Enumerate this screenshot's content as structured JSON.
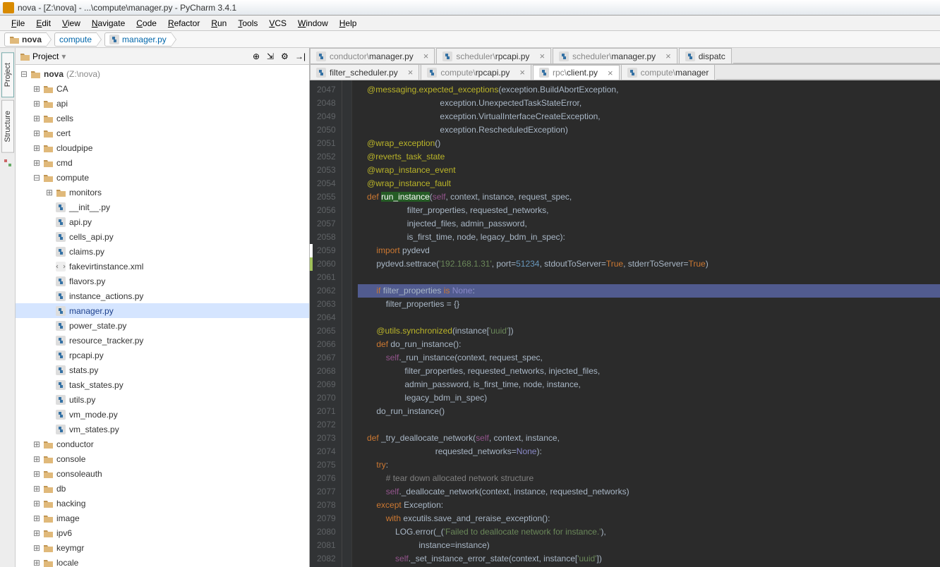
{
  "window": {
    "title": "nova - [Z:\\nova] - ...\\compute\\manager.py - PyCharm 3.4.1"
  },
  "menu": [
    "File",
    "Edit",
    "View",
    "Navigate",
    "Code",
    "Refactor",
    "Run",
    "Tools",
    "VCS",
    "Window",
    "Help"
  ],
  "breadcrumb": [
    {
      "label": "nova",
      "icon": "dir"
    },
    {
      "label": "compute",
      "icon": null
    },
    {
      "label": "manager.py",
      "icon": "py"
    }
  ],
  "project_panel": {
    "title": "Project",
    "toolbar_icons": [
      "target-icon",
      "collapse-icon",
      "gear-icon",
      "hide-icon"
    ]
  },
  "side_tabs": [
    "Project",
    "Structure"
  ],
  "tree": [
    {
      "depth": 0,
      "toggle": "−",
      "icon": "dir",
      "label": "nova",
      "suffix": "(Z:\\nova)",
      "bold": true
    },
    {
      "depth": 1,
      "toggle": "+",
      "icon": "dir",
      "label": "CA"
    },
    {
      "depth": 1,
      "toggle": "+",
      "icon": "dir",
      "label": "api"
    },
    {
      "depth": 1,
      "toggle": "+",
      "icon": "dir",
      "label": "cells"
    },
    {
      "depth": 1,
      "toggle": "+",
      "icon": "dir",
      "label": "cert"
    },
    {
      "depth": 1,
      "toggle": "+",
      "icon": "dir",
      "label": "cloudpipe"
    },
    {
      "depth": 1,
      "toggle": "+",
      "icon": "dir",
      "label": "cmd"
    },
    {
      "depth": 1,
      "toggle": "−",
      "icon": "dir",
      "label": "compute"
    },
    {
      "depth": 2,
      "toggle": "+",
      "icon": "dir",
      "label": "monitors"
    },
    {
      "depth": 2,
      "toggle": "",
      "icon": "py",
      "label": "__init__.py"
    },
    {
      "depth": 2,
      "toggle": "",
      "icon": "py",
      "label": "api.py"
    },
    {
      "depth": 2,
      "toggle": "",
      "icon": "py",
      "label": "cells_api.py"
    },
    {
      "depth": 2,
      "toggle": "",
      "icon": "py",
      "label": "claims.py"
    },
    {
      "depth": 2,
      "toggle": "",
      "icon": "xml",
      "label": "fakevirtinstance.xml"
    },
    {
      "depth": 2,
      "toggle": "",
      "icon": "py",
      "label": "flavors.py"
    },
    {
      "depth": 2,
      "toggle": "",
      "icon": "py",
      "label": "instance_actions.py"
    },
    {
      "depth": 2,
      "toggle": "",
      "icon": "py",
      "label": "manager.py",
      "selected": true
    },
    {
      "depth": 2,
      "toggle": "",
      "icon": "py",
      "label": "power_state.py"
    },
    {
      "depth": 2,
      "toggle": "",
      "icon": "py",
      "label": "resource_tracker.py"
    },
    {
      "depth": 2,
      "toggle": "",
      "icon": "py",
      "label": "rpcapi.py"
    },
    {
      "depth": 2,
      "toggle": "",
      "icon": "py",
      "label": "stats.py"
    },
    {
      "depth": 2,
      "toggle": "",
      "icon": "py",
      "label": "task_states.py"
    },
    {
      "depth": 2,
      "toggle": "",
      "icon": "py",
      "label": "utils.py"
    },
    {
      "depth": 2,
      "toggle": "",
      "icon": "py",
      "label": "vm_mode.py"
    },
    {
      "depth": 2,
      "toggle": "",
      "icon": "py",
      "label": "vm_states.py"
    },
    {
      "depth": 1,
      "toggle": "+",
      "icon": "dir",
      "label": "conductor"
    },
    {
      "depth": 1,
      "toggle": "+",
      "icon": "dir",
      "label": "console"
    },
    {
      "depth": 1,
      "toggle": "+",
      "icon": "dir",
      "label": "consoleauth"
    },
    {
      "depth": 1,
      "toggle": "+",
      "icon": "dir",
      "label": "db"
    },
    {
      "depth": 1,
      "toggle": "+",
      "icon": "dir",
      "label": "hacking"
    },
    {
      "depth": 1,
      "toggle": "+",
      "icon": "dir",
      "label": "image"
    },
    {
      "depth": 1,
      "toggle": "+",
      "icon": "dir",
      "label": "ipv6"
    },
    {
      "depth": 1,
      "toggle": "+",
      "icon": "dir",
      "label": "keymgr"
    },
    {
      "depth": 1,
      "toggle": "+",
      "icon": "dir",
      "label": "locale"
    }
  ],
  "tabs_row1": [
    {
      "path": "conductor\\",
      "file": "manager.py",
      "closeable": true
    },
    {
      "path": "scheduler\\",
      "file": "rpcapi.py",
      "closeable": true
    },
    {
      "path": "scheduler\\",
      "file": "manager.py",
      "closeable": true
    },
    {
      "path": "",
      "file": "dispatc",
      "closeable": false
    }
  ],
  "tabs_row2": [
    {
      "path": "",
      "file": "filter_scheduler.py",
      "closeable": true
    },
    {
      "path": "compute\\",
      "file": "rpcapi.py",
      "closeable": true
    },
    {
      "path": "rpc\\",
      "file": "client.py",
      "closeable": true,
      "active": true
    },
    {
      "path": "compute\\",
      "file": "manager",
      "closeable": false
    }
  ],
  "code": {
    "first_line": 2047,
    "lines": [
      [
        [
          "p",
          "    "
        ],
        [
          "dec",
          "@messaging.expected_exceptions"
        ],
        [
          "p",
          "(exception.BuildAbortException,"
        ]
      ],
      [
        [
          "p",
          "                                   exception.UnexpectedTaskStateError,"
        ]
      ],
      [
        [
          "p",
          "                                   exception.VirtualInterfaceCreateException,"
        ]
      ],
      [
        [
          "p",
          "                                   exception.RescheduledException)"
        ]
      ],
      [
        [
          "p",
          "    "
        ],
        [
          "dec",
          "@wrap_exception"
        ],
        [
          "p",
          "()"
        ]
      ],
      [
        [
          "p",
          "    "
        ],
        [
          "dec",
          "@reverts_task_state"
        ]
      ],
      [
        [
          "p",
          "    "
        ],
        [
          "dec",
          "@wrap_instance_event"
        ]
      ],
      [
        [
          "p",
          "    "
        ],
        [
          "dec",
          "@wrap_instance_fault"
        ]
      ],
      [
        [
          "p",
          "    "
        ],
        [
          "kw",
          "def "
        ],
        [
          "hlname",
          "run_instance"
        ],
        [
          "p",
          "("
        ],
        [
          "self",
          "self"
        ],
        [
          "p",
          ", context, instance, request_spec,"
        ]
      ],
      [
        [
          "p",
          "                     filter_properties, requested_networks,"
        ]
      ],
      [
        [
          "p",
          "                     injected_files, admin_password,"
        ]
      ],
      [
        [
          "p",
          "                     is_first_time, node, legacy_bdm_in_spec):"
        ]
      ],
      [
        [
          "p",
          "        "
        ],
        [
          "kw",
          "import"
        ],
        [
          "p",
          " pydevd"
        ]
      ],
      [
        [
          "p",
          "        pydevd.settrace("
        ],
        [
          "str",
          "'192.168.1.31'"
        ],
        [
          "p",
          ", port="
        ],
        [
          "num",
          "51234"
        ],
        [
          "p",
          ", stdoutToServer="
        ],
        [
          "kw",
          "True"
        ],
        [
          "p",
          ", stderrToServer="
        ],
        [
          "kw",
          "True"
        ],
        [
          "p",
          ")"
        ]
      ],
      [
        [
          "p",
          ""
        ]
      ],
      [
        [
          "hlrow",
          ""
        ],
        [
          "p",
          "        "
        ],
        [
          "kw",
          "if"
        ],
        [
          "p",
          " filter_properties "
        ],
        [
          "kw",
          "is"
        ],
        [
          "p",
          " "
        ],
        [
          "builtin",
          "None"
        ],
        [
          "p",
          ":"
        ]
      ],
      [
        [
          "p",
          "            filter_properties = {}"
        ]
      ],
      [
        [
          "p",
          ""
        ]
      ],
      [
        [
          "p",
          "        "
        ],
        [
          "dec",
          "@utils.synchronized"
        ],
        [
          "p",
          "(instance["
        ],
        [
          "str",
          "'uuid'"
        ],
        [
          "p",
          "])"
        ]
      ],
      [
        [
          "p",
          "        "
        ],
        [
          "kw",
          "def"
        ],
        [
          "p",
          " do_run_instance():"
        ]
      ],
      [
        [
          "p",
          "            "
        ],
        [
          "self",
          "self"
        ],
        [
          "p",
          "._run_instance(context, request_spec,"
        ]
      ],
      [
        [
          "p",
          "                    filter_properties, requested_networks, injected_files,"
        ]
      ],
      [
        [
          "p",
          "                    admin_password, is_first_time, node, instance,"
        ]
      ],
      [
        [
          "p",
          "                    legacy_bdm_in_spec)"
        ]
      ],
      [
        [
          "p",
          "        do_run_instance()"
        ]
      ],
      [
        [
          "p",
          ""
        ]
      ],
      [
        [
          "p",
          "    "
        ],
        [
          "kw",
          "def"
        ],
        [
          "p",
          " _try_deallocate_network("
        ],
        [
          "self",
          "self"
        ],
        [
          "p",
          ", context, instance,"
        ]
      ],
      [
        [
          "p",
          "                                 requested_networks="
        ],
        [
          "builtin",
          "None"
        ],
        [
          "p",
          "):"
        ]
      ],
      [
        [
          "p",
          "        "
        ],
        [
          "kw",
          "try"
        ],
        [
          "p",
          ":"
        ]
      ],
      [
        [
          "p",
          "            "
        ],
        [
          "comment",
          "# tear down allocated network structure"
        ]
      ],
      [
        [
          "p",
          "            "
        ],
        [
          "self",
          "self"
        ],
        [
          "p",
          "._deallocate_network(context, instance, requested_networks)"
        ]
      ],
      [
        [
          "p",
          "        "
        ],
        [
          "kw",
          "except"
        ],
        [
          "p",
          " Exception:"
        ]
      ],
      [
        [
          "p",
          "            "
        ],
        [
          "kw",
          "with"
        ],
        [
          "p",
          " excutils.save_and_reraise_exception():"
        ]
      ],
      [
        [
          "p",
          "                LOG.error(_("
        ],
        [
          "str",
          "'Failed to deallocate network for instance.'"
        ],
        [
          "p",
          "),"
        ]
      ],
      [
        [
          "p",
          "                          instance=instance)"
        ]
      ],
      [
        [
          "p",
          "                "
        ],
        [
          "self",
          "self"
        ],
        [
          "p",
          "._set_instance_error_state(context, instance["
        ],
        [
          "str",
          "'uuid'"
        ],
        [
          "p",
          "])"
        ]
      ]
    ]
  }
}
